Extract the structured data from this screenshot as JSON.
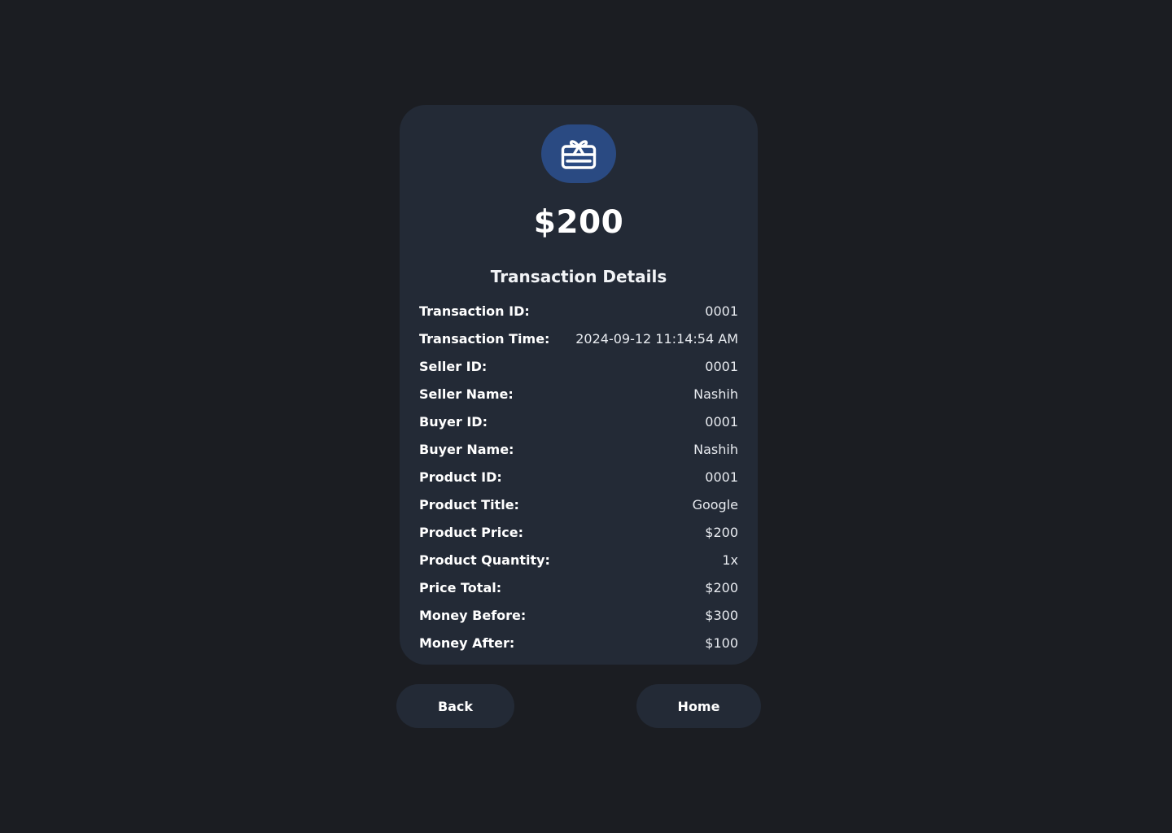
{
  "transaction": {
    "amount": "$200",
    "icon": "gift-card-icon",
    "section_title": "Transaction Details",
    "details": [
      {
        "label": "Transaction ID:",
        "value": "0001"
      },
      {
        "label": "Transaction Time:",
        "value": "2024-09-12 11:14:54 AM"
      },
      {
        "label": "Seller ID:",
        "value": "0001"
      },
      {
        "label": "Seller Name:",
        "value": "Nashih"
      },
      {
        "label": "Buyer ID:",
        "value": "0001"
      },
      {
        "label": "Buyer Name:",
        "value": "Nashih"
      },
      {
        "label": "Product ID:",
        "value": "0001"
      },
      {
        "label": "Product Title:",
        "value": "Google"
      },
      {
        "label": "Product Price:",
        "value": "$200"
      },
      {
        "label": "Product Quantity:",
        "value": "1x"
      },
      {
        "label": "Price Total:",
        "value": "$200"
      },
      {
        "label": "Money Before:",
        "value": "$300"
      },
      {
        "label": "Money After:",
        "value": "$100"
      }
    ]
  },
  "actions": {
    "back_label": "Back",
    "home_label": "Home"
  },
  "colors": {
    "background": "#1b1d22",
    "card": "#232a36",
    "icon_badge": "#2a4a82",
    "text": "#ffffff"
  }
}
